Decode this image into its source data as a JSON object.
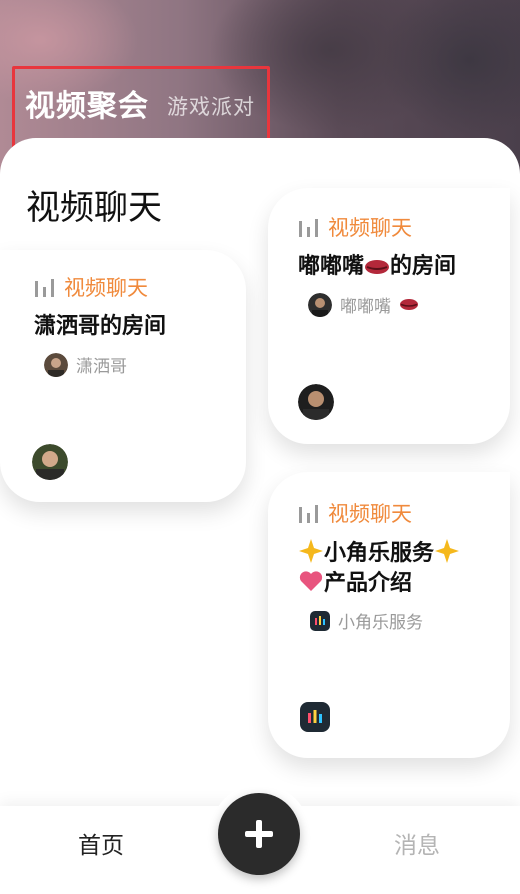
{
  "header": {
    "tab_active": "视频聚会",
    "tab_inactive": "游戏派对"
  },
  "section": {
    "title": "视频聊天"
  },
  "cards": [
    {
      "tag": "视频聊天",
      "room": "潇洒哥的房间",
      "host": "潇洒哥"
    },
    {
      "tag": "视频聊天",
      "room_prefix": "嘟嘟嘴",
      "room_suffix": "的房间",
      "room_emoji": "lips",
      "host": "嘟嘟嘴",
      "host_emoji": "lips"
    },
    {
      "tag": "视频聊天",
      "room_line1": "小角乐服务",
      "room_line2": "产品介绍",
      "room_emoji": [
        "sparkle",
        "heart"
      ],
      "host": "小角乐服务"
    }
  ],
  "tabbar": {
    "home": "首页",
    "add": "+",
    "messages": "消息"
  },
  "colors": {
    "accent_tag": "#f08a3c",
    "highlight_border": "#e8363d",
    "fab": "#2b2b2b"
  }
}
